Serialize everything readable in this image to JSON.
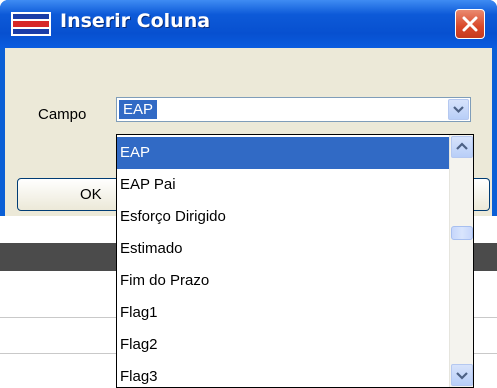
{
  "dialog": {
    "title": "Inserir Coluna",
    "close_icon": "close-icon",
    "campo_label": "Campo",
    "selected_value": "EAP",
    "ok_label": "OK"
  },
  "dropdown": {
    "items": [
      "EAP",
      "EAP Pai",
      "Esforço Dirigido",
      "Estimado",
      "Fim do Prazo",
      "Flag1",
      "Flag2",
      "Flag3"
    ],
    "selected_index": 0
  },
  "colors": {
    "titlebar": "#0a5cdf",
    "selection": "#316ac5",
    "dialog_body": "#ece9d8",
    "close_button": "#d9482a"
  }
}
